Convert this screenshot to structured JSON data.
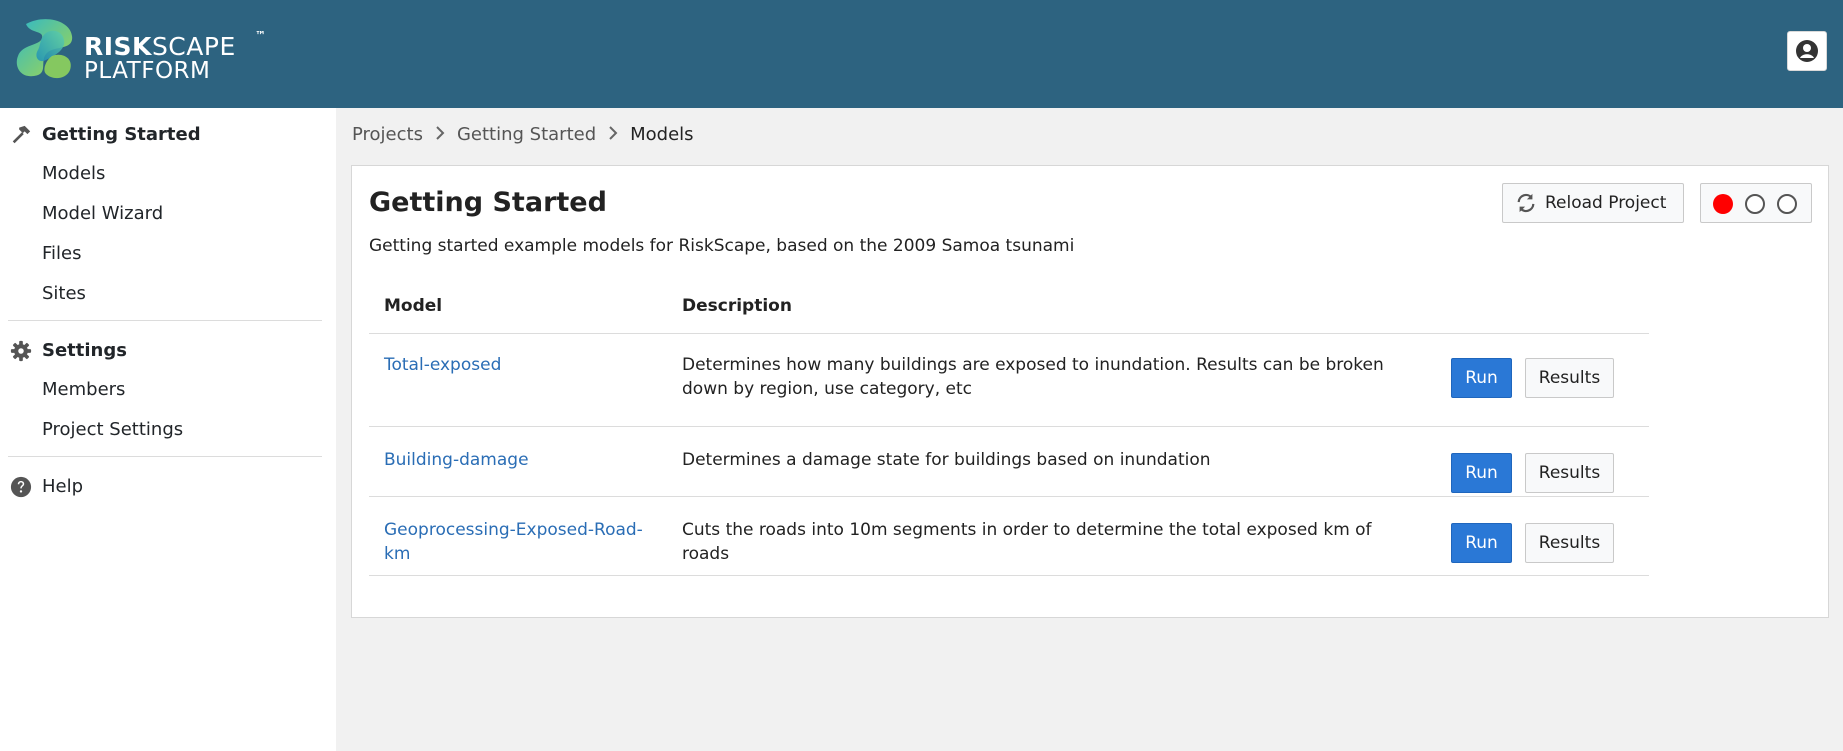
{
  "header": {
    "logo_risk": "RISK",
    "logo_scape": "SCAPE",
    "logo_tm": "™",
    "logo_platform": "PLATFORM"
  },
  "sidebar": {
    "project_section": {
      "icon": "hammer-icon",
      "label": "Getting Started",
      "items": [
        {
          "label": "Models"
        },
        {
          "label": "Model Wizard"
        },
        {
          "label": "Files"
        },
        {
          "label": "Sites"
        }
      ]
    },
    "settings_section": {
      "icon": "gear-icon",
      "label": "Settings",
      "items": [
        {
          "label": "Members"
        },
        {
          "label": "Project Settings"
        }
      ]
    },
    "help": {
      "icon": "question-circle-icon",
      "label": "Help"
    }
  },
  "breadcrumb": {
    "items": [
      "Projects",
      "Getting Started",
      "Models"
    ]
  },
  "card": {
    "title": "Getting Started",
    "description": "Getting started example models for RiskScape, based on the 2009 Samoa tsunami",
    "reload_label": "Reload Project",
    "status_colors": {
      "active": "#ff0000"
    }
  },
  "table": {
    "headers": [
      "Model",
      "Description"
    ],
    "rows": [
      {
        "model": "Total-exposed",
        "description": "Determines how many buildings are exposed to inundation. Results can be broken down by region, use category, etc",
        "run": "Run",
        "results": "Results"
      },
      {
        "model": "Building-damage",
        "description": "Determines a damage state for buildings based on inundation",
        "run": "Run",
        "results": "Results"
      },
      {
        "model": "Geoprocessing-Exposed-Road-km",
        "description": "Cuts the roads into 10m segments in order to determine the total exposed km of roads",
        "run": "Run",
        "results": "Results"
      }
    ]
  },
  "colors": {
    "header_bg": "#2d6380",
    "link": "#2a6db5",
    "primary": "#2a78d6"
  }
}
